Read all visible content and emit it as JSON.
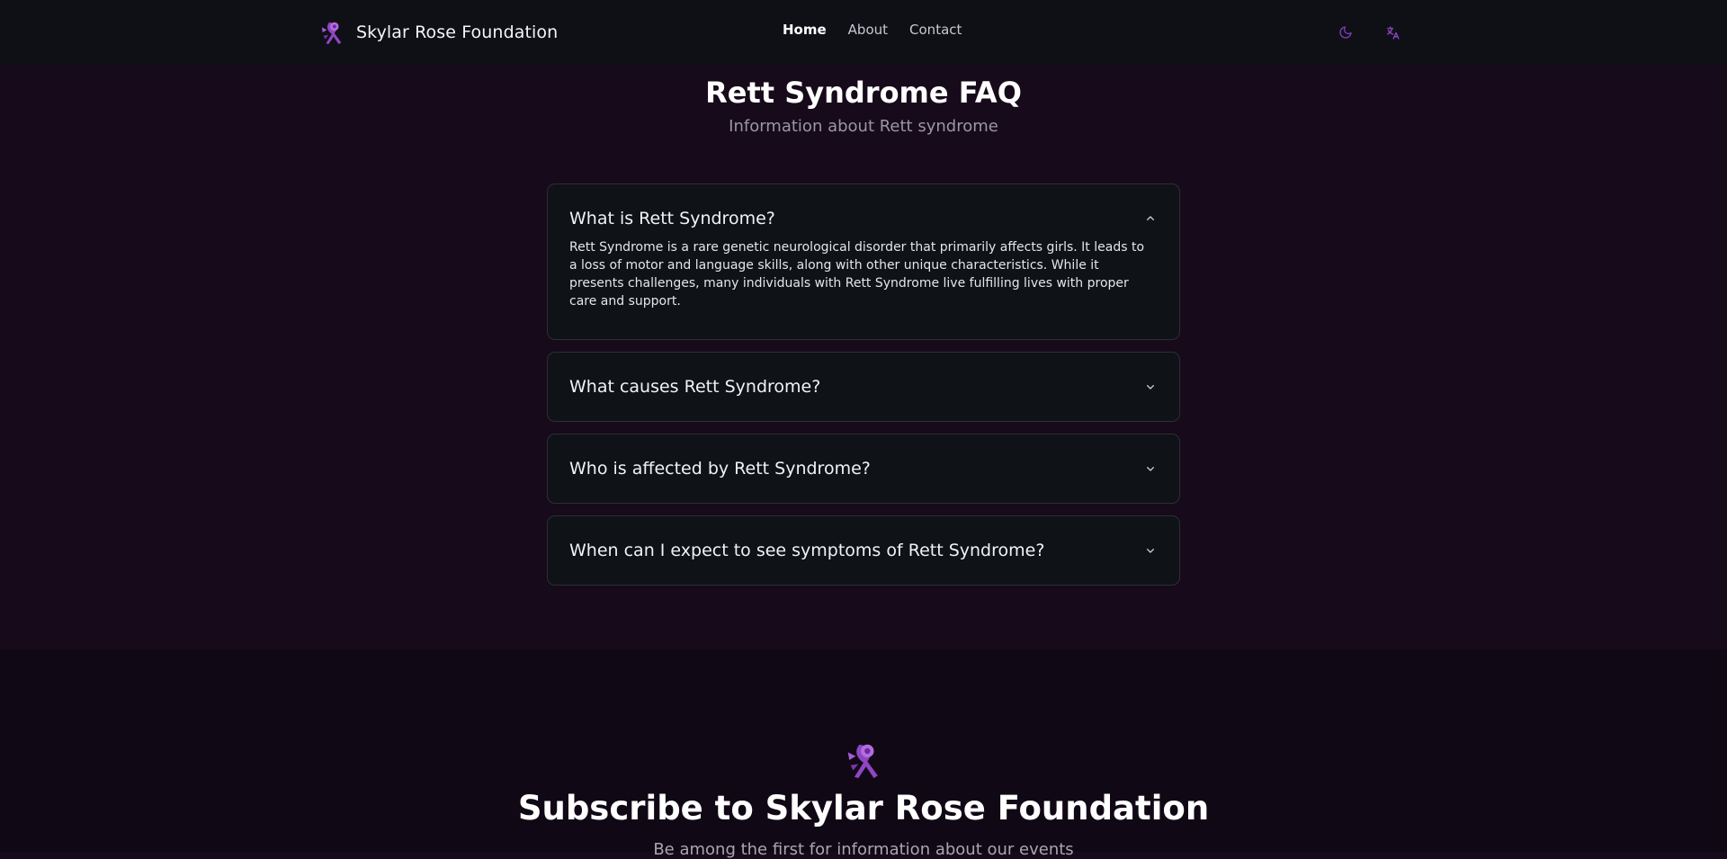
{
  "nav": {
    "brand": "Skylar Rose Foundation",
    "links": [
      {
        "label": "Home",
        "active": true
      },
      {
        "label": "About",
        "active": false
      },
      {
        "label": "Contact",
        "active": false
      }
    ],
    "theme_icon": "moon-icon",
    "language_icon": "translate-icon"
  },
  "faq": {
    "title": "Rett Syndrome FAQ",
    "subtitle": "Information about Rett syndrome",
    "items": [
      {
        "question": "What is Rett Syndrome?",
        "answer": "Rett Syndrome is a rare genetic neurological disorder that primarily affects girls. It leads to a loss of motor and language skills, along with other unique characteristics. While it presents challenges, many individuals with Rett Syndrome live fulfilling lives with proper care and support.",
        "expanded": true
      },
      {
        "question": "What causes Rett Syndrome?",
        "expanded": false
      },
      {
        "question": "Who is affected by Rett Syndrome?",
        "expanded": false
      },
      {
        "question": "When can I expect to see symptoms of Rett Syndrome?",
        "expanded": false
      }
    ]
  },
  "subscribe": {
    "title": "Subscribe to Skylar Rose Foundation",
    "text": "Be among the first for information about our events"
  },
  "colors": {
    "accent": "#9b4fd0",
    "background": "#170a1b",
    "navbar": "#0e1016",
    "card": "#0f1216"
  }
}
